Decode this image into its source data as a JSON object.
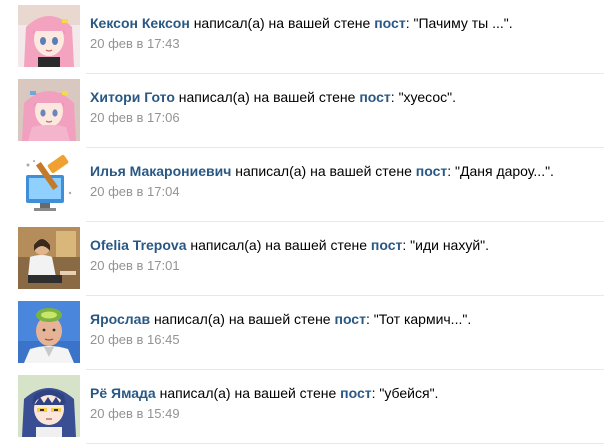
{
  "notifications": [
    {
      "author": "Кексон Кексон",
      "action": "написал(а) на вашей стене",
      "target": "пост",
      "quote": "\"Пачиму ты ...\".",
      "time": "20 фев в 17:43",
      "avatar": "pink-hair-anime-girl"
    },
    {
      "author": "Хитори Гото",
      "action": "написал(а) на вашей стене",
      "target": "пост",
      "quote": "\"хуесос\".",
      "time": "20 фев в 17:06",
      "avatar": "pink-hair-anime-girl-pink-jacket"
    },
    {
      "author": "Илья Макарониевич",
      "action": "написал(а) на вашей стене",
      "target": "пост",
      "quote": "\"Даня дароу...\".",
      "time": "20 фев в 17:04",
      "avatar": "hammer-monitor-icon"
    },
    {
      "author": "Ofelia Trepova",
      "action": "написал(а) на вашей стене",
      "target": "пост",
      "quote": "\"иди нахуй\".",
      "time": "20 фев в 17:01",
      "avatar": "photo-person"
    },
    {
      "author": "Ярослав",
      "action": "написал(а) на вашей стене",
      "target": "пост",
      "quote": "\"Тот кармич...\".",
      "time": "20 фев в 16:45",
      "avatar": "man-with-kiwi"
    },
    {
      "author": "Рё Ямада",
      "action": "написал(а) на вашей стене",
      "target": "пост",
      "quote": "\"убейся\".",
      "time": "20 фев в 15:49",
      "avatar": "blue-hair-anime-girl"
    }
  ]
}
